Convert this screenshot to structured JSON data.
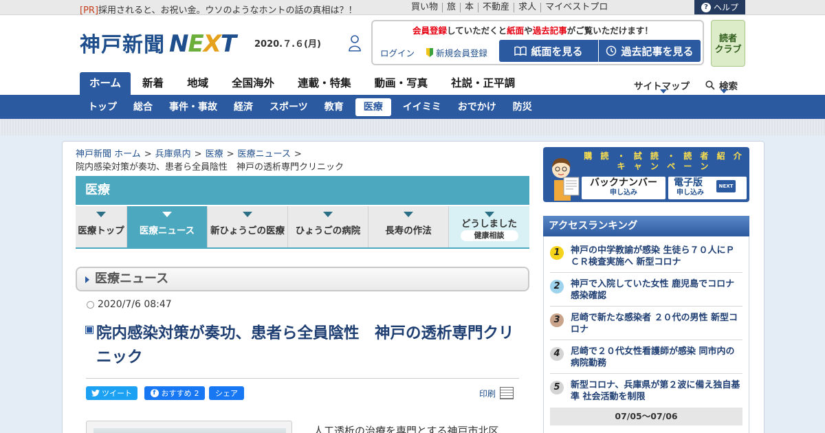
{
  "topbar": {
    "pr_tag": "[PR]",
    "pr_text": "採用されると、お祝い金。ウソのようなホントの話の真相は？！",
    "links": [
      "買い物",
      "旅",
      "本",
      "不動産",
      "求人",
      "マイベストプロ"
    ],
    "help_label": "ヘルプ"
  },
  "header": {
    "logo_jp": "神戸新聞",
    "logo_next": [
      "N",
      "E",
      "X",
      "T"
    ],
    "date": "2020.７.６(月)",
    "member_msg_parts": [
      "会員登録",
      "していただくと",
      "紙面",
      "や",
      "過去記事",
      "がご覧いただけます！"
    ],
    "login": "ログイン",
    "signup": "新規会員登録",
    "btn_paper": "紙面を見る",
    "btn_archive": "過去記事を見る",
    "reader_line1": "読者",
    "reader_line2": "クラブ"
  },
  "main_nav": {
    "items": [
      "ホーム",
      "新着",
      "地域",
      "全国海外",
      "連載・特集",
      "動画・写真",
      "社説・正平調"
    ],
    "active_index": 0,
    "sitemap": "サイトマップ",
    "search": "検索"
  },
  "sub_nav": {
    "items": [
      "トップ",
      "総合",
      "事件・事故",
      "経済",
      "スポーツ",
      "教育",
      "医療",
      "イイミミ",
      "おでかけ",
      "防災"
    ],
    "active_index": 6
  },
  "breadcrumb": {
    "items": [
      "神戸新聞 ホーム",
      "兵庫県内",
      "医療",
      "医療ニュース"
    ],
    "separator": ">",
    "current": "院内感染対策が奏功、患者ら全員陰性　神戸の透析専門クリニック"
  },
  "section": {
    "title": "医療",
    "tabs": [
      "医療トップ",
      "医療ニュース",
      "新ひょうごの医療",
      "ひょうごの病院",
      "長寿の作法"
    ],
    "active_tab": 1,
    "extra_tab_line1": "どうしました",
    "extra_tab_line2": "健康相談"
  },
  "article": {
    "category_head": "医療ニュース",
    "timestamp": "2020/7/6 08:47",
    "title": "院内感染対策が奏功、患者ら全員陰性　神戸の透析専門クリニック",
    "tweet": "ツイート",
    "fb_recommend": "おすすめ",
    "fb_count": "2",
    "share": "シェア",
    "print": "印刷",
    "body_start": "人工透析の治療を専門とする神戸市北区"
  },
  "campaign": {
    "title_line1": "購 読 ・ 試 読 ・ 読 者 紹 介",
    "title_line2": "キ ャ ン ペ ー ン",
    "box1_main": "バックナンバー",
    "box1_sub": "申し込み",
    "box2_main": "電子版",
    "box2_sub": "申し込み",
    "next_badge": "NEXT"
  },
  "ranking": {
    "title": "アクセスランキング",
    "items": [
      {
        "rank": "1",
        "text": "神戸の中学教諭が感染 生徒ら７０人にＰＣＲ検査実施へ 新型コロナ",
        "color": "#f5d31b"
      },
      {
        "rank": "2",
        "text": "神戸で入院していた女性 鹿児島でコロナ感染確認",
        "color": "#9ed3ee"
      },
      {
        "rank": "3",
        "text": "尼崎で新たな感染者 ２０代の男性 新型コロナ",
        "color": "#c9a48a"
      },
      {
        "rank": "4",
        "text": "尼崎で２０代女性看護師が感染 同市内の病院勤務",
        "color": "#d4d4d4"
      },
      {
        "rank": "5",
        "text": "新型コロナ、兵庫県が第２波に備え独自基準 社会活動を制限",
        "color": "#d4d4d4"
      }
    ],
    "period": "07/05～07/06"
  }
}
